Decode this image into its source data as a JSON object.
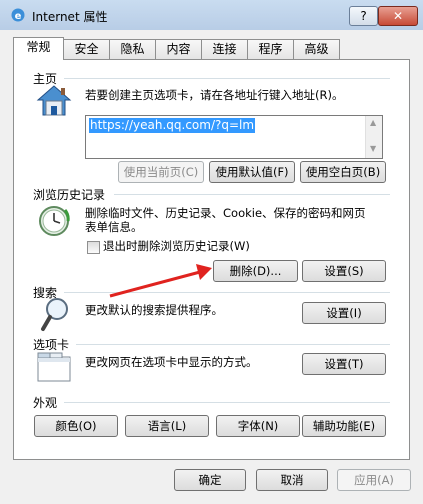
{
  "window": {
    "title": "Internet 属性",
    "help": "?",
    "close": "✕"
  },
  "tabs": [
    "常规",
    "安全",
    "隐私",
    "内容",
    "连接",
    "程序",
    "高级"
  ],
  "home": {
    "heading": "主页",
    "desc": "若要创建主页选项卡，请在各地址行键入地址(R)。",
    "url": "https://yeah.qq.com/?q=lm",
    "btn_current": "使用当前页(C)",
    "btn_default": "使用默认值(F)",
    "btn_blank": "使用空白页(B)"
  },
  "history": {
    "heading": "浏览历史记录",
    "desc_line1": "删除临时文件、历史记录、Cookie、保存的密码和网页",
    "desc_line2": "表单信息。",
    "checkbox_label": "退出时删除浏览历史记录(W)",
    "btn_delete": "删除(D)...",
    "btn_settings": "设置(S)"
  },
  "search": {
    "heading": "搜索",
    "desc": "更改默认的搜索提供程序。",
    "btn_settings": "设置(I)"
  },
  "tabs_section": {
    "heading": "选项卡",
    "desc": "更改网页在选项卡中显示的方式。",
    "btn_settings": "设置(T)"
  },
  "appearance": {
    "heading": "外观",
    "btn_colors": "颜色(O)",
    "btn_languages": "语言(L)",
    "btn_fonts": "字体(N)",
    "btn_accessibility": "辅助功能(E)"
  },
  "footer": {
    "ok": "确定",
    "cancel": "取消",
    "apply": "应用(A)"
  }
}
